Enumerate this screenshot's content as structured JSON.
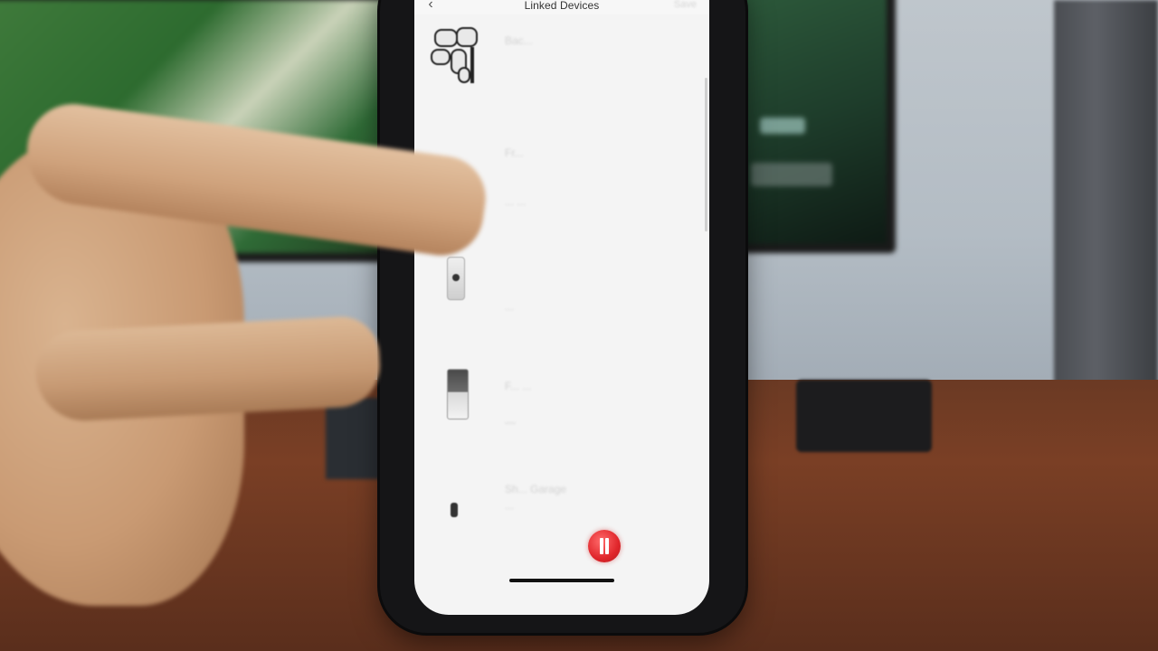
{
  "app": {
    "title": "Linked Devices",
    "nav_right": "Save",
    "back_icon": "chevron-left-icon",
    "back_glyph": "‹"
  },
  "devices": [
    {
      "name": "Bac...",
      "sub": "",
      "thumb": "camera-kit"
    },
    {
      "name": "Fr...",
      "sub": "... ...",
      "thumb": "none"
    },
    {
      "name": "",
      "sub": "...",
      "thumb": "doorbell"
    },
    {
      "name": "F... ...",
      "sub": "—",
      "thumb": "doorbell-dark"
    },
    {
      "name": "Sh... Garage",
      "sub": "...",
      "thumb": "small-device"
    }
  ],
  "controls": {
    "record_icon": "pause-icon",
    "record_color": "#e0262b"
  }
}
